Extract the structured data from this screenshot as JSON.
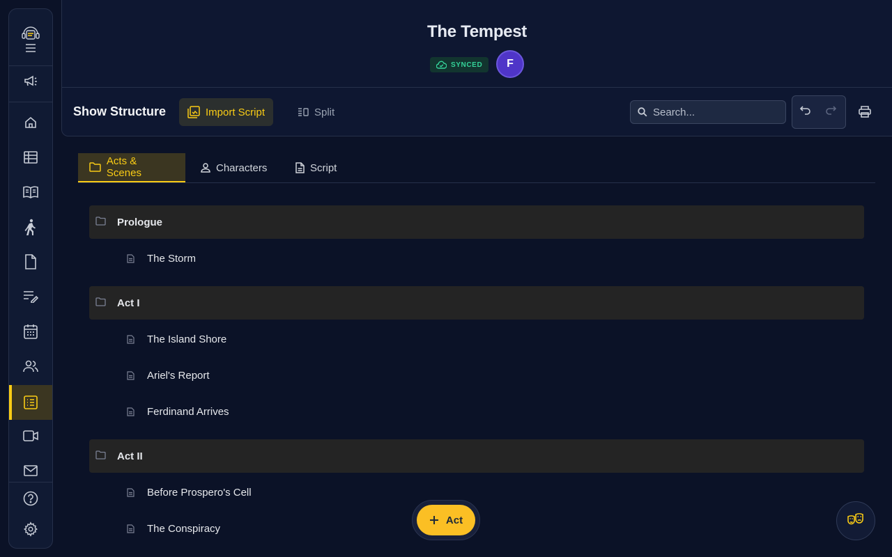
{
  "app": {
    "title": "The Tempest",
    "sync_status": "SYNCED",
    "user_initial": "F"
  },
  "sidebar": {
    "items": [
      {
        "name": "logo",
        "icon": "support-agent-icon"
      },
      {
        "name": "menu",
        "icon": "menu-icon"
      },
      {
        "name": "announcements",
        "icon": "megaphone-icon"
      },
      {
        "name": "home",
        "icon": "home-icon"
      },
      {
        "name": "table",
        "icon": "table-icon"
      },
      {
        "name": "script-book",
        "icon": "book-icon"
      },
      {
        "name": "blocking",
        "icon": "walking-person-icon"
      },
      {
        "name": "documents",
        "icon": "document-icon"
      },
      {
        "name": "notes",
        "icon": "edit-list-icon"
      },
      {
        "name": "calendar",
        "icon": "calendar-icon"
      },
      {
        "name": "people",
        "icon": "people-icon"
      },
      {
        "name": "show-structure",
        "icon": "list-icon",
        "active": true
      },
      {
        "name": "video",
        "icon": "video-icon"
      },
      {
        "name": "mail",
        "icon": "mail-icon"
      },
      {
        "name": "help",
        "icon": "help-icon"
      },
      {
        "name": "settings",
        "icon": "gear-icon"
      }
    ]
  },
  "toolbar": {
    "title": "Show Structure",
    "import_label": "Import Script",
    "split_label": "Split",
    "search_placeholder": "Search..."
  },
  "tabs": [
    {
      "label": "Acts & Scenes",
      "active": true
    },
    {
      "label": "Characters",
      "active": false
    },
    {
      "label": "Script",
      "active": false
    }
  ],
  "structure": [
    {
      "act": "Prologue",
      "scenes": [
        "The Storm"
      ]
    },
    {
      "act": "Act I",
      "scenes": [
        "The Island Shore",
        "Ariel's Report",
        "Ferdinand Arrives"
      ]
    },
    {
      "act": "Act II",
      "scenes": [
        "Before Prospero's Cell",
        "The Conspiracy"
      ]
    }
  ],
  "fab": {
    "label": "Act"
  },
  "colors": {
    "background": "#0b1227",
    "accent": "#facc15",
    "synced": "#34d399",
    "avatar": "#4f35c8"
  }
}
